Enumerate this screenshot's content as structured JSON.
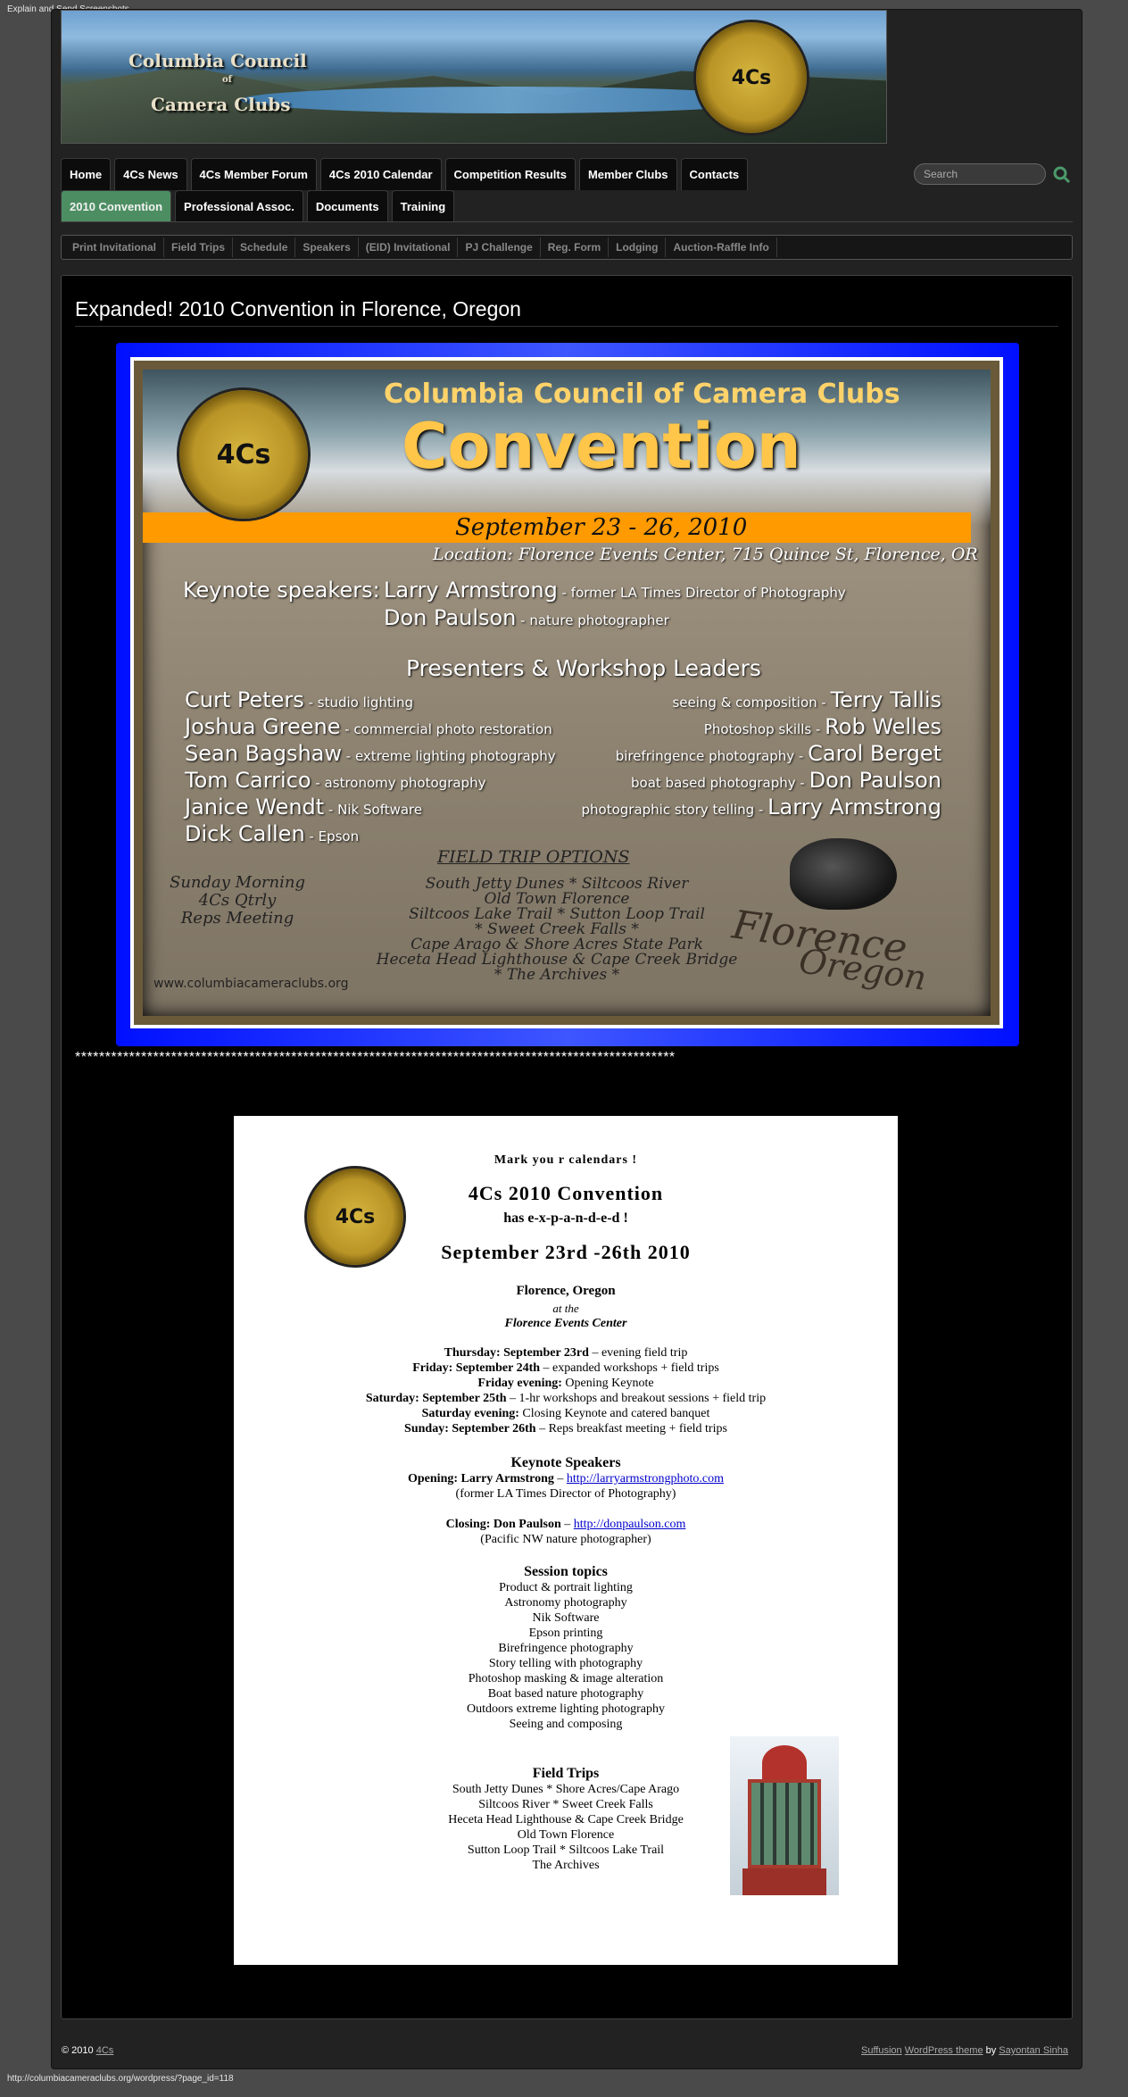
{
  "browser": {
    "top_text": "Explain and Send Screenshots",
    "status_url": "http://columbiacameraclubs.org/wordpress/?page_id=118"
  },
  "banner": {
    "line1": "Columbia Council",
    "line2": "of",
    "line3": "Camera Clubs",
    "seal_text": "4Cs"
  },
  "nav": {
    "row1": [
      "Home",
      "4Cs News",
      "4Cs Member Forum",
      "4Cs 2010 Calendar",
      "Competition Results",
      "Member Clubs",
      "Contacts"
    ],
    "row2": [
      "2010 Convention",
      "Professional Assoc.",
      "Documents",
      "Training"
    ],
    "active": "2010 Convention"
  },
  "search": {
    "placeholder": "Search"
  },
  "subnav": [
    "Print Invitational",
    "Field Trips",
    "Schedule",
    "Speakers",
    "(EID) Invitational",
    "PJ Challenge",
    "Reg. Form",
    "Lodging",
    "Auction-Raffle Info"
  ],
  "page": {
    "title": "Expanded! 2010 Convention in Florence, Oregon"
  },
  "poster": {
    "seal_text": "4Cs",
    "org": "Columbia Council of Camera Clubs",
    "headline": "Convention",
    "dates": "September 23 - 26, 2010",
    "location": "Location:   Florence Events Center,  715 Quince St,  Florence,  OR",
    "keynote_label": "Keynote speakers:",
    "keynote1_name": "Larry Armstrong",
    "keynote1_desc": " - former LA Times Director of Photography",
    "keynote2_name": "Don Paulson",
    "keynote2_desc": " - nature photographer",
    "presenters_title": "Presenters & Workshop Leaders",
    "left": [
      {
        "name": "Curt Peters",
        "desc": " - studio lighting"
      },
      {
        "name": "Joshua Greene",
        "desc": " - commercial photo restoration"
      },
      {
        "name": "Sean Bagshaw",
        "desc": " - extreme lighting photography"
      },
      {
        "name": "Tom Carrico",
        "desc": " - astronomy photography"
      },
      {
        "name": "Janice Wendt",
        "desc": " - Nik Software"
      },
      {
        "name": "Dick Callen",
        "desc": " - Epson"
      }
    ],
    "right": [
      {
        "desc": "seeing & composition - ",
        "name": "Terry Tallis"
      },
      {
        "desc": "Photoshop skills - ",
        "name": "Rob Welles"
      },
      {
        "desc": "birefringence photography - ",
        "name": "Carol Berget"
      },
      {
        "desc": "boat based photography - ",
        "name": "Don Paulson"
      },
      {
        "desc": "photographic story telling - ",
        "name": "Larry Armstrong"
      }
    ],
    "field_trip_title": "FIELD TRIP OPTIONS",
    "field_trips": [
      "South Jetty Dunes   *   Siltcoos River",
      "Old Town Florence",
      "Siltcoos Lake Trail   *   Sutton Loop Trail",
      "*   Sweet Creek Falls   *",
      "Cape Arago & Shore Acres State Park",
      "Heceta Head Lighthouse & Cape Creek Bridge",
      "*   The Archives   *"
    ],
    "sunday": "Sunday Morning\n4Cs Qtrly\nReps Meeting",
    "url": "www.columbiacameraclubs.org",
    "sand_line1": "Florence",
    "sand_line2": "Oregon"
  },
  "divider": "****************************************************************************************************",
  "doc": {
    "seal_text": "4Cs",
    "mark": "Mark  you r calendars !",
    "title": "4Cs 2010  Convention",
    "expanded": "has  e-x-p-a-n-d-e-d  !",
    "dates": "September  23rd -26th 2010",
    "city": "Florence,  Oregon",
    "at_the": "at the",
    "venue": "Florence Events Center",
    "schedule": [
      {
        "day": "Thursday:  September 23rd",
        "text": " – evening field trip"
      },
      {
        "day": "Friday:  September 24th",
        "text": " – expanded workshops + field trips"
      },
      {
        "day": "Friday evening:",
        "text": "  Opening Keynote"
      },
      {
        "day": "Saturday:  September 25th",
        "text": " – 1-hr workshops and breakout sessions + field trip"
      },
      {
        "day": "Saturday evening:",
        "text": "  Closing Keynote and catered banquet"
      },
      {
        "day": "Sunday:  September 26th",
        "text": " – Reps breakfast meeting + field trips"
      }
    ],
    "keynote_heading": "Keynote Speakers",
    "opening_label": "Opening:  Larry Armstrong",
    "opening_link": "http://larryarmstrongphoto.com",
    "opening_note": "(former LA Times Director of Photography)",
    "closing_label": "Closing:  Don Paulson",
    "closing_link": "http://donpaulson.com",
    "closing_note": "(Pacific NW nature photographer)",
    "topics_heading": "Session topics",
    "topics": [
      "Product & portrait lighting",
      "Astronomy photography",
      "Nik Software",
      "Epson printing",
      "Birefringence photography",
      "Story telling with photography",
      "Photoshop masking & image alteration",
      "Boat based nature photography",
      "Outdoors extreme lighting photography",
      "Seeing and composing"
    ],
    "trips_heading": "Field Trips",
    "trips": [
      "South Jetty Dunes   *   Shore Acres/Cape Arago",
      "Siltcoos River   *   Sweet Creek Falls",
      "Heceta Head Lighthouse & Cape Creek Bridge",
      "Old Town Florence",
      "Sutton Loop Trail   *   Siltcoos Lake Trail",
      "The Archives"
    ]
  },
  "footer": {
    "copy": "© 2010 ",
    "site": "4Cs",
    "theme": "Suffusion",
    "wp": "WordPress theme",
    "by": " by ",
    "author": "Sayontan Sinha"
  }
}
